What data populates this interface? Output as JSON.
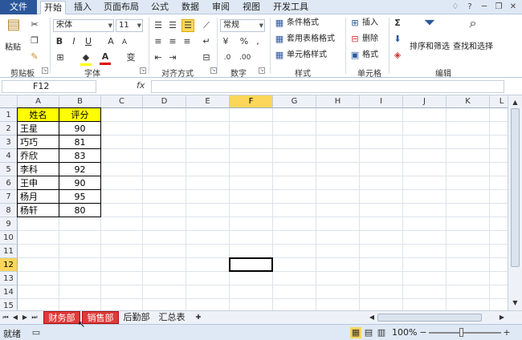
{
  "ribbon_tabs": {
    "file": "文件",
    "items": [
      "开始",
      "插入",
      "页面布局",
      "公式",
      "数据",
      "审阅",
      "视图",
      "开发工具"
    ]
  },
  "window_controls": [
    "♢",
    "?",
    "─",
    "❐",
    "✕"
  ],
  "clipboard": {
    "paste": "粘贴",
    "label": "剪贴板"
  },
  "font": {
    "name": "宋体",
    "size": "11",
    "bold": "B",
    "italic": "I",
    "underline": "U",
    "grow": "A",
    "shrink": "A",
    "label": "字体",
    "wen": "变"
  },
  "alignment": {
    "label": "对齐方式"
  },
  "number": {
    "format": "常规",
    "percent": "%",
    "comma": ",",
    "label": "数字"
  },
  "styles": {
    "conditional": "条件格式",
    "table": "套用表格格式",
    "cell": "单元格样式",
    "label": "样式"
  },
  "cells": {
    "insert": "插入",
    "delete": "删除",
    "format": "格式",
    "label": "单元格"
  },
  "editing": {
    "sigma": "Σ",
    "sort": "排序和筛选",
    "find": "查找和选择",
    "label": "编辑"
  },
  "formula_bar": {
    "name_box": "F12",
    "fx": "fx",
    "value": ""
  },
  "columns": [
    "A",
    "B",
    "C",
    "D",
    "E",
    "F",
    "G",
    "H",
    "I",
    "J",
    "K",
    "L"
  ],
  "selected_column": "F",
  "rows": [
    "1",
    "2",
    "3",
    "4",
    "5",
    "6",
    "7",
    "8",
    "9",
    "10",
    "11",
    "12",
    "13",
    "14",
    "15"
  ],
  "selected_row": "12",
  "table": {
    "headers": [
      "姓名",
      "评分"
    ],
    "rows": [
      [
        "王星",
        "90"
      ],
      [
        "巧巧",
        "81"
      ],
      [
        "乔欣",
        "83"
      ],
      [
        "李科",
        "92"
      ],
      [
        "王申",
        "90"
      ],
      [
        "杨月",
        "95"
      ],
      [
        "杨轩",
        "80"
      ]
    ]
  },
  "sheets": [
    "财务部",
    "销售部",
    "后勤部",
    "汇总表"
  ],
  "status": {
    "ready": "就绪",
    "zoom": "100%",
    "minus": "−",
    "plus": "+"
  },
  "colors": {
    "header_fill": "#ffff00",
    "sheet_active": "#e03a3a",
    "file_tab": "#2b579a",
    "selection": "#fbd65a"
  }
}
